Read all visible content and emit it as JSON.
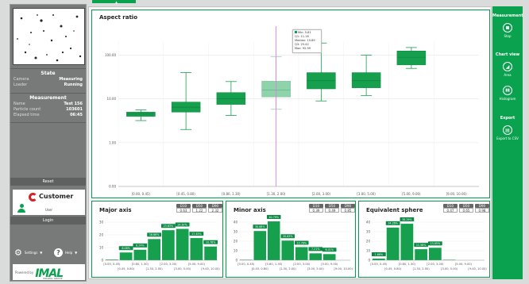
{
  "left_panel": {
    "state": {
      "title": "State",
      "rows": [
        {
          "label": "Camera",
          "value": "Measuring"
        },
        {
          "label": "Loader",
          "value": "Running"
        }
      ]
    },
    "measurement": {
      "title": "Measurement",
      "rows": [
        {
          "label": "Name",
          "value": "Test 156"
        },
        {
          "label": "Particle count",
          "value": "103601"
        },
        {
          "label": "Elapsed time",
          "value": "06:45"
        }
      ]
    },
    "reset_label": "Reset",
    "customer": {
      "logo_text": "Customer",
      "user_label": "User"
    },
    "login_label": "Login",
    "settings_label": "Settings",
    "help_label": "Help",
    "powered_by": "Powered by",
    "brand": "IMAL",
    "brand_sub": "IMALPAL GROUP"
  },
  "right_panel": {
    "measurement_title": "Measurement",
    "stop_label": "Stop",
    "chart_view_title": "Chart view",
    "area_label": "Area",
    "histogram_label": "Histogram",
    "export_title": "Export",
    "export_csv_label": "Export to CSV"
  },
  "tooltip": {
    "lines": [
      "Min: 5.81",
      "Q1: 11.16",
      "Median: 15.89",
      "Q3: 25.42",
      "Max: 92.99"
    ]
  },
  "colors": {
    "accent": "#0aa14f",
    "box": "#16a04e",
    "highlight_box": "#8fd3aa",
    "cursor_line": "#e27ce8"
  },
  "chart_data": [
    {
      "type": "box",
      "title": "Aspect ratio",
      "yscale": "log",
      "ylim": [
        0.1,
        200
      ],
      "y_ticks": [
        "100.00",
        "10.00",
        "1.00",
        "0.00"
      ],
      "categories": [
        "[0.00, 0.45)",
        "[0.45, 0.80)",
        "[0.80, 1.30)",
        "[1.30, 2.00)",
        "[2.00, 3.00)",
        "[3.00, 5.00)",
        "[5.00, 9.00)",
        "[9.00, 10.00)"
      ],
      "boxes": [
        {
          "min": 3.2,
          "q1": 4.0,
          "median": 4.5,
          "q3": 5.0,
          "max": 5.6
        },
        {
          "min": 2.0,
          "q1": 5.0,
          "median": 6.5,
          "q3": 8.5,
          "max": 40
        },
        {
          "min": 4.2,
          "q1": 7.5,
          "median": 10,
          "q3": 14,
          "max": 25
        },
        {
          "min": 5.81,
          "q1": 11.16,
          "median": 15.89,
          "q3": 25.42,
          "max": 92.99
        },
        {
          "min": 9,
          "q1": 17,
          "median": 26,
          "q3": 40,
          "max": 190
        },
        {
          "min": 12,
          "q1": 18,
          "median": 26,
          "q3": 40,
          "max": 100
        },
        {
          "min": 50,
          "q1": 60,
          "median": 90,
          "q3": 125,
          "max": 150
        },
        null
      ],
      "highlight_index": 3
    },
    {
      "type": "bar",
      "title": "Major axis",
      "stats": [
        {
          "label": "D10",
          "value": "0.63"
        },
        {
          "label": "D50",
          "value": "1.22"
        },
        {
          "label": "D90",
          "value": "2.32"
        }
      ],
      "ylim": [
        0,
        30
      ],
      "y_ticks": [
        "30",
        "20",
        "10",
        "0"
      ],
      "categories": [
        "[0.00, 0.45)",
        "[0.45, 0.80)",
        "[0.80, 1.30)",
        "[1.30, 2.00)",
        "[2.00, 3.00)",
        "[3.00, 5.00)",
        "[5.00, 9.00)",
        "[9.00, 10.00)"
      ],
      "values": [
        0.5,
        6.08,
        8.24,
        16.66,
        23.63,
        24.67,
        17.45,
        10.78
      ],
      "labels": [
        "",
        "6.08%",
        "8.24%",
        "16.66%",
        "23.63%",
        "24.67%",
        "17.45%",
        "10.78%"
      ]
    },
    {
      "type": "bar",
      "title": "Minor axis",
      "stats": [
        {
          "label": "D10",
          "value": "0.39"
        },
        {
          "label": "D50",
          "value": "0.49"
        },
        {
          "label": "D90",
          "value": "0.85"
        }
      ],
      "ylim": [
        0,
        40
      ],
      "y_ticks": [
        "40",
        "30",
        "20",
        "10",
        "0"
      ],
      "categories": [
        "[0.00, 0.45)",
        "[0.45, 0.80)",
        "[0.80, 1.30)",
        "[1.30, 2.00)",
        "[2.00, 3.00)",
        "[3.00, 5.00)",
        "[5.00, 9.00)",
        "[9.00, 10.00)"
      ],
      "values": [
        0.5,
        30.68,
        40.79,
        20.63,
        13.76,
        7.21,
        6.41,
        0
      ],
      "labels": [
        "",
        "30.68%",
        "40.79%",
        "20.63%",
        "13.76%",
        "7.21%",
        "6.41%",
        ""
      ]
    },
    {
      "type": "bar",
      "title": "Equivalent sphere",
      "stats": [
        {
          "label": "D10",
          "value": "0.47"
        },
        {
          "label": "D50",
          "value": "0.65"
        },
        {
          "label": "D90",
          "value": "0.98"
        }
      ],
      "ylim": [
        0,
        40
      ],
      "y_ticks": [
        "40",
        "30",
        "20",
        "10",
        "0"
      ],
      "categories": [
        "[0.00, 0.45)",
        "[0.45, 0.80)",
        "[0.80, 1.30)",
        "[1.30, 2.00)",
        "[2.00, 3.00)",
        "[3.00, 5.00)",
        "[5.00, 9.00)",
        "[9.00, 10.00)"
      ],
      "values": [
        1.68,
        34.26,
        38.29,
        11.56,
        13.05,
        0.5,
        0,
        0
      ],
      "labels": [
        "1.68%",
        "34.26%",
        "38.29%",
        "11.56%",
        "13.05%",
        "",
        "",
        ""
      ]
    }
  ]
}
